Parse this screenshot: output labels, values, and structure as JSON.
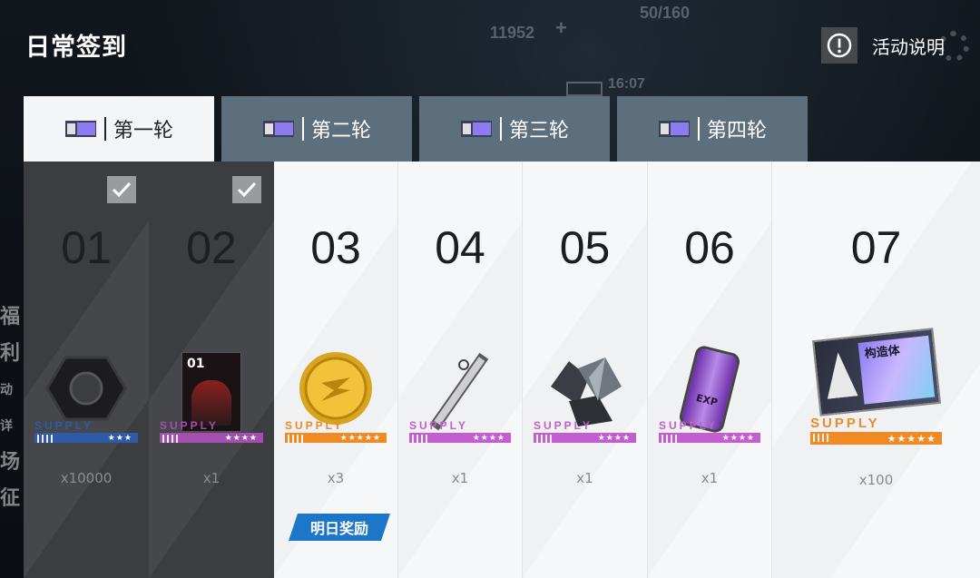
{
  "header": {
    "title": "日常签到",
    "info_label": "活动说明",
    "hud": {
      "coins": "11952",
      "plus": "+",
      "stamina": "50/160",
      "time": "16:07"
    }
  },
  "background_left_text": [
    "福利",
    "动详",
    "场",
    "征"
  ],
  "tabs": [
    {
      "label": "第一轮",
      "active": true
    },
    {
      "label": "第二轮",
      "active": false
    },
    {
      "label": "第三轮",
      "active": false
    },
    {
      "label": "第四轮",
      "active": false
    }
  ],
  "days": [
    {
      "num": "01",
      "claimed": true,
      "item": "hex-nut-icon",
      "supply": "SUPPLY",
      "stars": "★★★",
      "color": "#2f5aa8",
      "qty": "x10000"
    },
    {
      "num": "02",
      "claimed": true,
      "item": "card-icon",
      "card_label": "01",
      "supply": "SUPPLY",
      "stars": "★★★★",
      "color": "#a44fb0",
      "qty": "x1"
    },
    {
      "num": "03",
      "claimed": false,
      "item": "gold-coin-icon",
      "supply": "SUPPLY",
      "stars": "★★★★★",
      "color": "#f08a24",
      "qty": "x3",
      "badge": "明日奖励"
    },
    {
      "num": "04",
      "claimed": false,
      "item": "rod-icon",
      "supply": "SUPPLY",
      "stars": "★★★★",
      "color": "#c35ed0",
      "qty": "x1"
    },
    {
      "num": "05",
      "claimed": false,
      "item": "crystal-icon",
      "supply": "SUPPLY",
      "stars": "★★★★",
      "color": "#c35ed0",
      "qty": "x1"
    },
    {
      "num": "06",
      "claimed": false,
      "item": "exp-canister-icon",
      "canister_label": "EXP",
      "supply": "SUPPLY",
      "stars": "★★★★",
      "color": "#c35ed0",
      "qty": "x1"
    },
    {
      "num": "07",
      "claimed": false,
      "item": "construct-ticket-icon",
      "ticket_label": "构造体",
      "supply": "SUPPLY",
      "stars": "★★★★★",
      "color": "#f08a24",
      "qty": "x100"
    }
  ]
}
